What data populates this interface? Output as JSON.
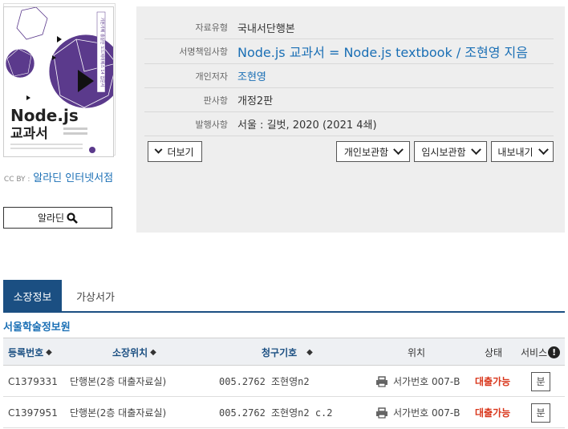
{
  "cover": {
    "title_line1": "Node.js",
    "title_line2": "교과서",
    "spine_text": "기본기에 충실한 노드제이에스 14 입문서"
  },
  "source": {
    "cc_label": "CC BY :",
    "provider": "알라딘 인터넷서점",
    "aladin_button": "알라딘"
  },
  "details": [
    {
      "label": "자료유형",
      "value": "국내서단행본"
    },
    {
      "label": "서명책임사항",
      "value": "Node.js 교과서 = Node.js textbook / 조현영 지음"
    },
    {
      "label": "개인저자",
      "value": "조현영"
    },
    {
      "label": "판사항",
      "value": "개정2판"
    },
    {
      "label": "발행사항",
      "value": "서울 : 길벗, 2020 (2021 4쇄)"
    }
  ],
  "actions": {
    "more": "더보기",
    "personal_shelf": "개인보관함",
    "temp_shelf": "임시보관함",
    "export": "내보내기"
  },
  "tabs": [
    "소장정보",
    "가상서가"
  ],
  "library_name": "서울학술정보원",
  "table": {
    "headers": {
      "reg_no": "등록번호",
      "location": "소장위치",
      "call_no": "청구기호",
      "position": "위치",
      "status": "상태",
      "service": "서비스"
    },
    "rows": [
      {
        "reg_no": "C1379331",
        "location": "단행본(2층 대출자료실)",
        "call_no": "005.2762 조현영n2",
        "position": "서가번호 007-B",
        "status": "대출가능",
        "service": "분"
      },
      {
        "reg_no": "C1397951",
        "location": "단행본(2층 대출자료실)",
        "call_no": "005.2762 조현영n2 c.2",
        "position": "서가번호 007-B",
        "status": "대출가능",
        "service": "분"
      }
    ]
  },
  "colors": {
    "accent": "#1b4f82",
    "link": "#1a6fb5",
    "status_available": "#d9361b",
    "panel_bg": "#eeeeee",
    "cover_purple": "#5b3a8c"
  }
}
